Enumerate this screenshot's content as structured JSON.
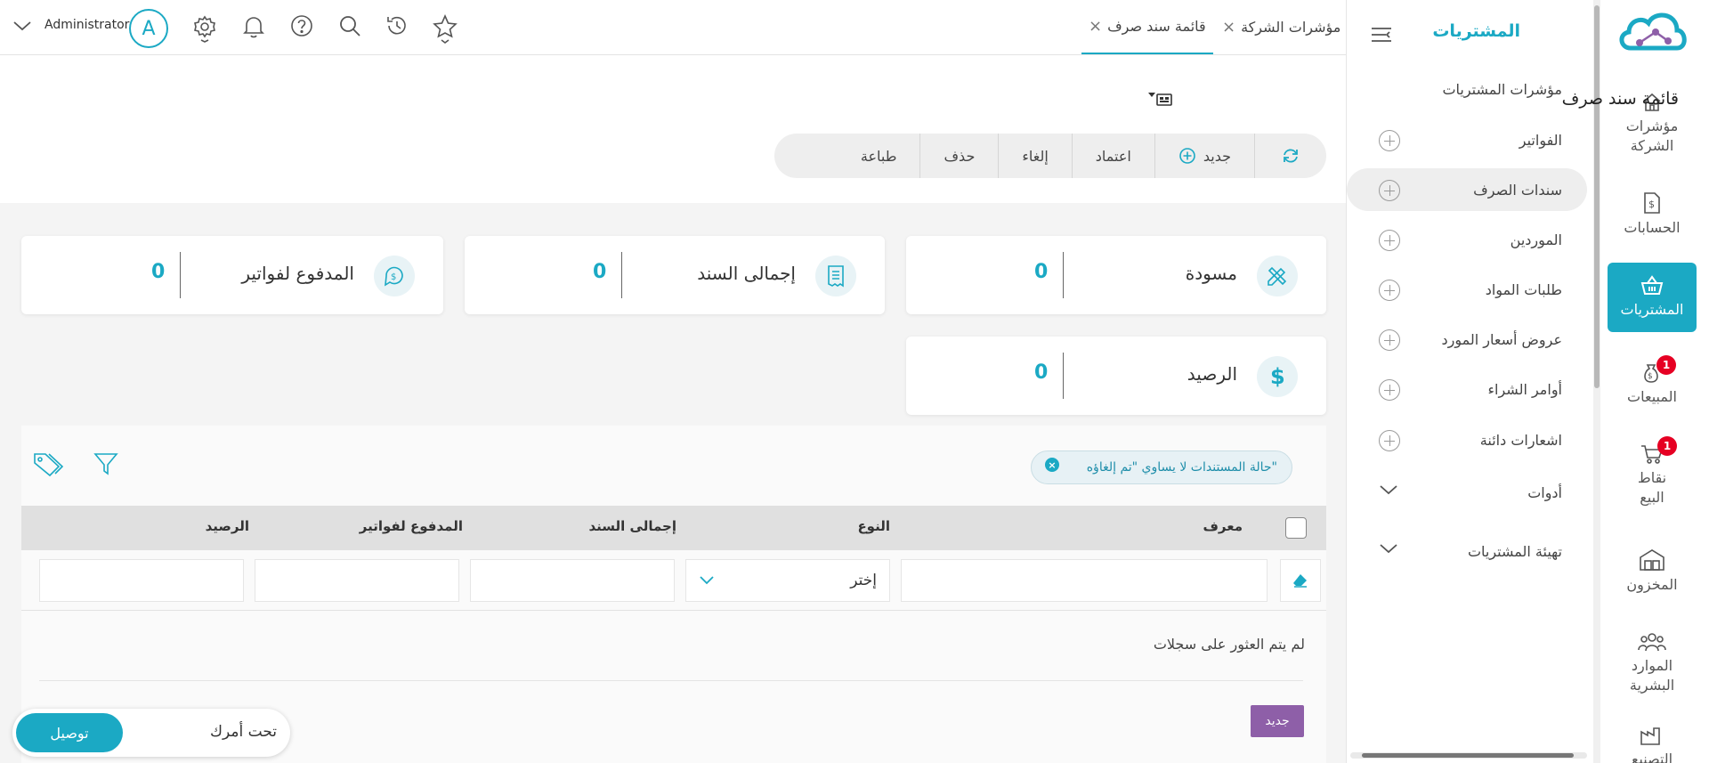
{
  "colors": {
    "accent": "#1ba9c4",
    "badge": "#e60023",
    "new_button": "#8e5fa8"
  },
  "rail": {
    "items": [
      {
        "label_1": "مؤشرات",
        "label_2": "الشركة",
        "icon": "home-icon"
      },
      {
        "label_1": "الحسابات",
        "label_2": "",
        "icon": "invoice-icon"
      },
      {
        "label_1": "المشتريات",
        "label_2": "",
        "icon": "basket-icon",
        "active": true
      },
      {
        "label_1": "المبيعات",
        "label_2": "",
        "icon": "money-bag-icon",
        "badge": "1"
      },
      {
        "label_1": "نقاط",
        "label_2": "البيع",
        "icon": "cart-icon",
        "badge": "1"
      },
      {
        "label_1": "المخزون",
        "label_2": "",
        "icon": "warehouse-icon"
      },
      {
        "label_1": "الموارد",
        "label_2": "البشرية",
        "icon": "people-icon"
      },
      {
        "label_1": "التصنيع",
        "label_2": "",
        "icon": "factory-icon"
      }
    ]
  },
  "sidebar": {
    "title": "المشتريات",
    "items": [
      {
        "label": "مؤشرات المشتريات",
        "action": "none"
      },
      {
        "label": "الفواتير",
        "action": "plus"
      },
      {
        "label": "سندات الصرف",
        "action": "plus",
        "active": true
      },
      {
        "label": "الموردين",
        "action": "plus"
      },
      {
        "label": "طلبات المواد",
        "action": "plus"
      },
      {
        "label": "عروض أسعار المورد",
        "action": "plus"
      },
      {
        "label": "أوامر الشراء",
        "action": "plus"
      },
      {
        "label": "اشعارات دائنة",
        "action": "plus"
      },
      {
        "label": "أدوات",
        "action": "chevron"
      },
      {
        "label": "تهيئة المشتريات",
        "action": "chevron"
      }
    ]
  },
  "topbar": {
    "user_name": "Administrator",
    "avatar_letter": "A",
    "tabs": [
      {
        "label": "مؤشرات الشركة",
        "active": false
      },
      {
        "label": "قائمة سند صرف",
        "active": true
      }
    ]
  },
  "page": {
    "title": "قائمة سند صرف",
    "toolbar": {
      "new": "جديد",
      "approve": "اعتماد",
      "cancel": "إلغاء",
      "delete": "حذف",
      "print": "طباعة"
    }
  },
  "cards": [
    {
      "label": "مسودة",
      "value": "0",
      "icon": "pencil-ruler-icon"
    },
    {
      "label": "إجمالى السند",
      "value": "0",
      "icon": "receipt-icon"
    },
    {
      "label": "المدفوع لفواتير",
      "value": "0",
      "icon": "cash-icon"
    },
    {
      "label": "الرصيد",
      "value": "0",
      "icon": "dollar-icon"
    }
  ],
  "filter": {
    "chip_text": "حالة المستندات لا يساوي \"تم إلغاؤه\""
  },
  "table": {
    "columns": {
      "id": "معرف",
      "type": "النوع",
      "total": "إجمالى السند",
      "paid": "المدفوع لفواتير",
      "balance": "الرصيد"
    },
    "type_select_value": "إختر",
    "empty_message": "لم يتم العثور على سجلات",
    "new_button": "جديد"
  },
  "status_widget": {
    "text": "تحت أمرك",
    "button": "توصيل"
  }
}
